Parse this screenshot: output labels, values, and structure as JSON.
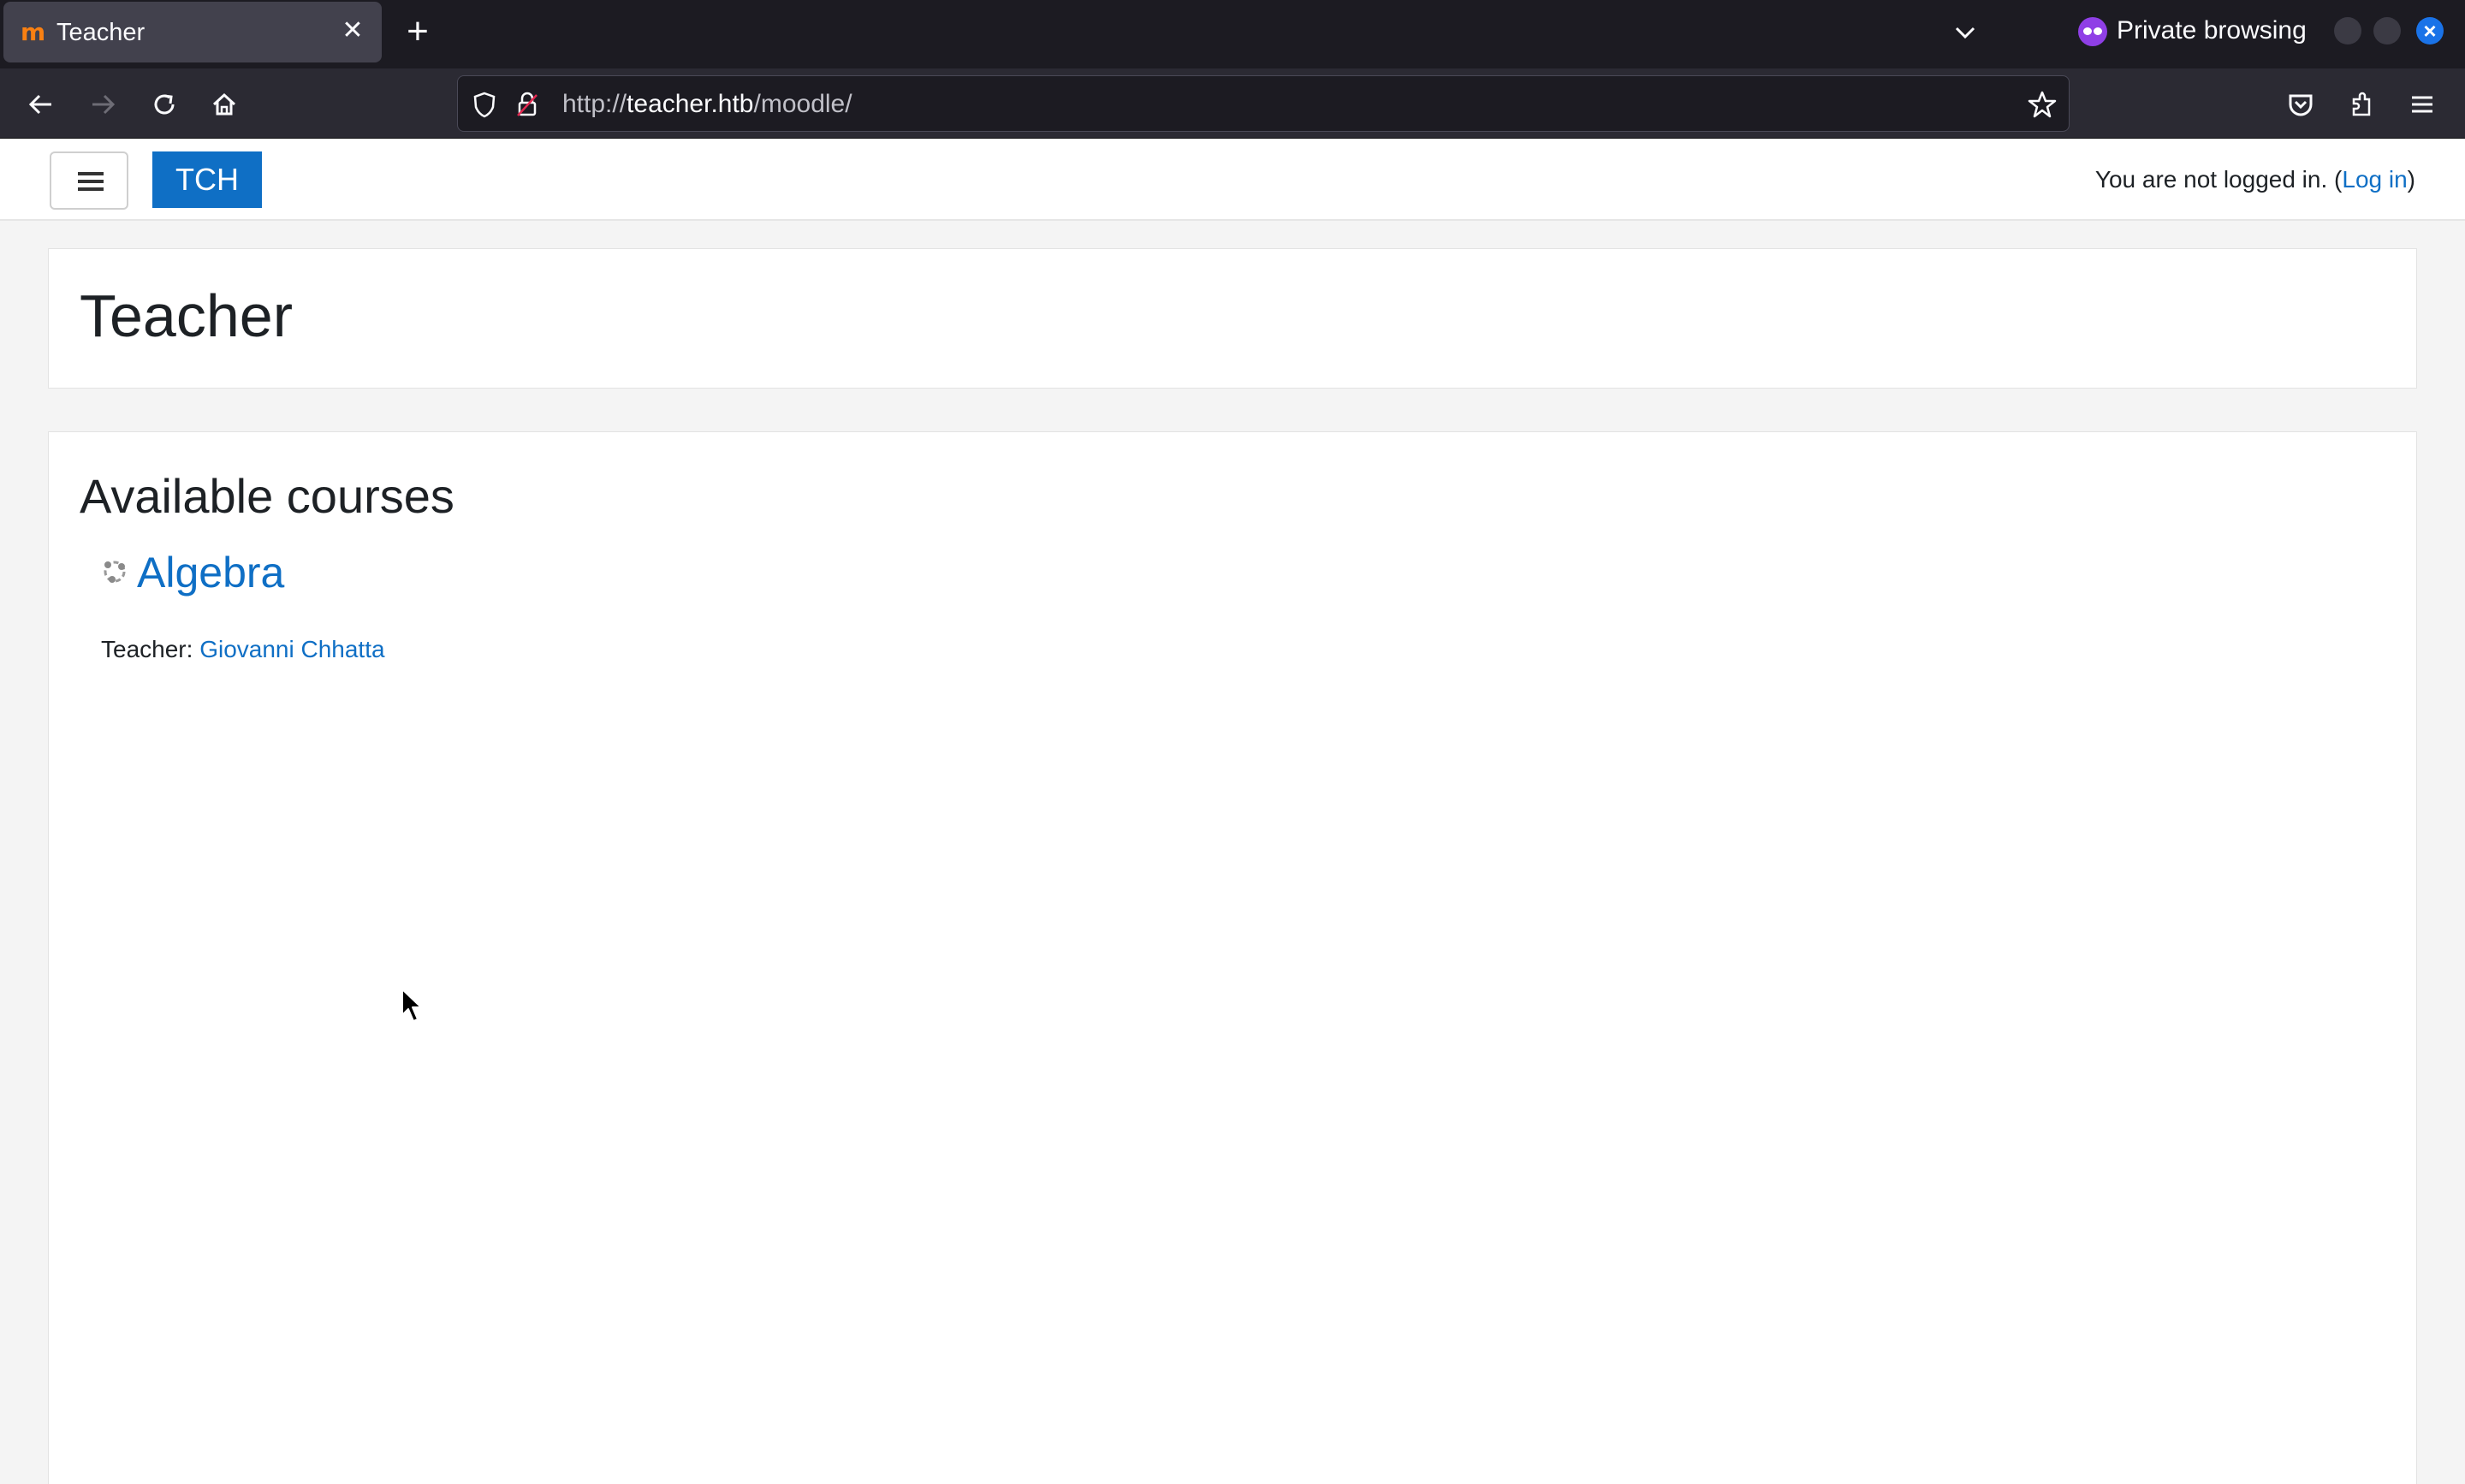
{
  "browser": {
    "tab": {
      "title": "Teacher"
    },
    "private_label": "Private browsing",
    "url": {
      "protocol": "http://",
      "host": "teacher.htb",
      "path": "/moodle/"
    },
    "colors": {
      "tab_active": "#42414d",
      "chrome": "#1c1b22",
      "private": "#8f3fe6",
      "close_accent": "#1a73e8"
    }
  },
  "site": {
    "brand": "TCH",
    "login_prefix": "You are not logged in. (",
    "login_link": "Log in",
    "login_suffix": ")",
    "colors": {
      "brand": "#0f6fc5",
      "link": "#0f6fc5"
    }
  },
  "page": {
    "title": "Teacher",
    "section_title": "Available courses",
    "courses": [
      {
        "name": "Algebra",
        "teacher_label": "Teacher:",
        "teacher_name": "Giovanni Chhatta"
      }
    ]
  },
  "icons": {
    "tab_favicon": "moodle-logo",
    "tab_close": "close-icon",
    "new_tab": "plus-icon",
    "back": "arrow-left-icon",
    "forward": "arrow-right-icon",
    "reload": "reload-icon",
    "home": "home-icon",
    "shield": "shield-icon",
    "lock": "lock-icon",
    "bookmark": "star-icon",
    "pocket": "pocket-icon",
    "extensions": "puzzle-icon",
    "app_menu": "hamburger-icon",
    "course": "course-icon"
  }
}
